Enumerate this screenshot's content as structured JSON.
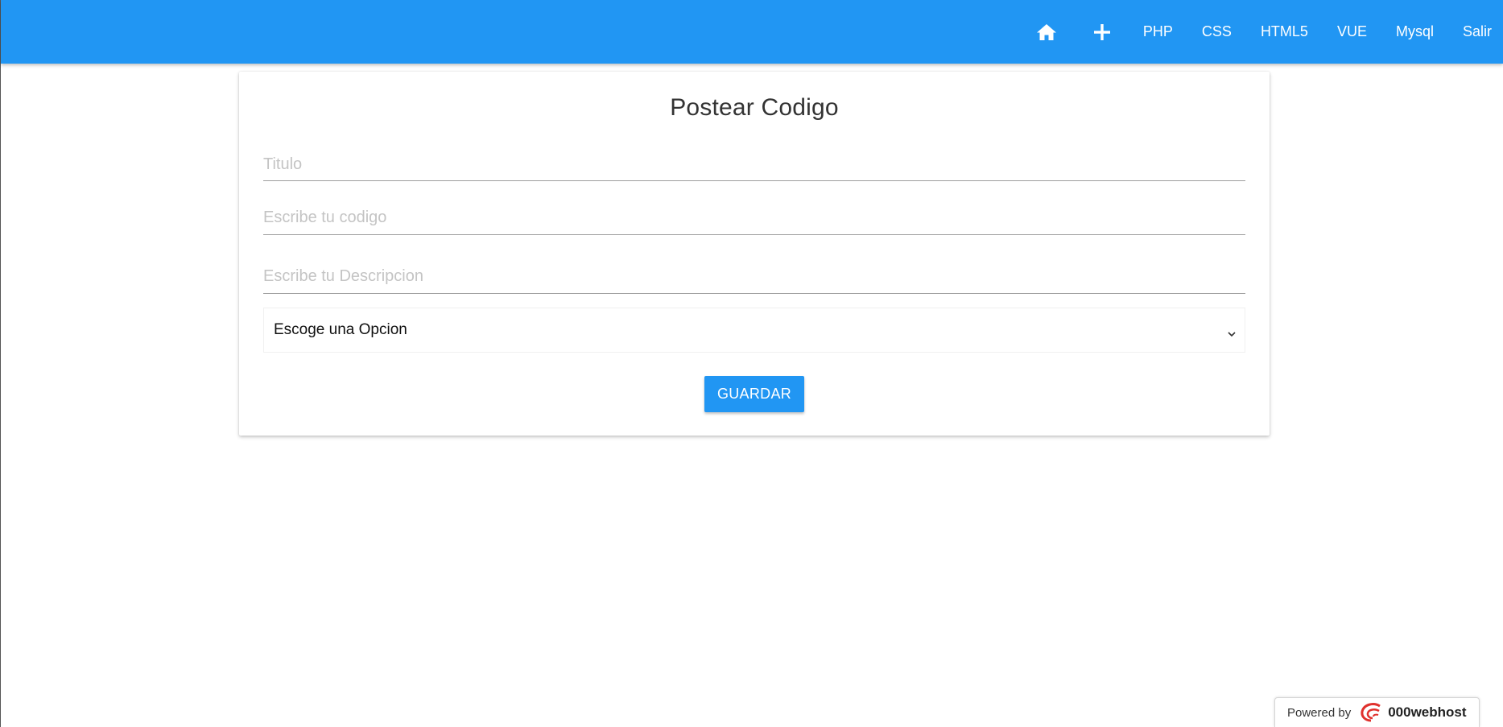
{
  "nav": {
    "home_icon": "home-icon",
    "add_icon": "plus-icon",
    "items": [
      "PHP",
      "CSS",
      "HTML5",
      "VUE",
      "Mysql",
      "Salir"
    ]
  },
  "form": {
    "title": "Postear Codigo",
    "titulo_placeholder": "Titulo",
    "codigo_placeholder": "Escribe tu codigo",
    "descripcion_placeholder": "Escribe tu Descripcion",
    "select_value": "Escoge una Opcion",
    "save_label": "GUARDAR"
  },
  "footer": {
    "powered_by": "Powered by",
    "brand": "000webhost"
  },
  "colors": {
    "primary": "#2196f3",
    "brand_red": "#e0312d"
  }
}
